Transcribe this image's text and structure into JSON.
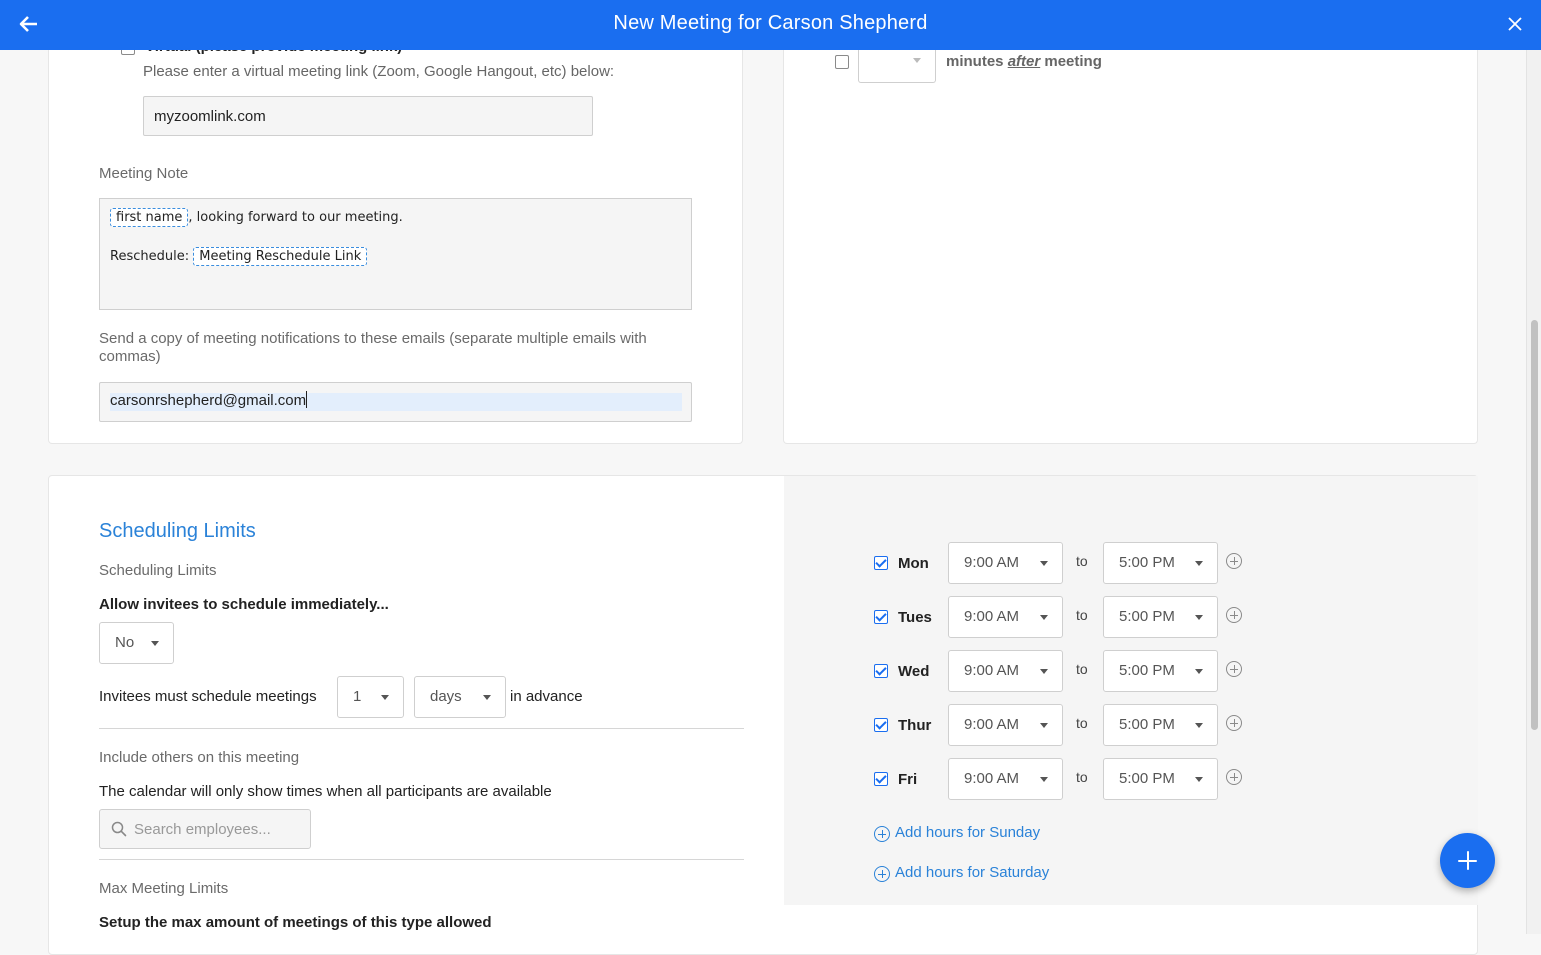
{
  "header": {
    "title": "New Meeting for Carson Shepherd"
  },
  "location": {
    "virtual_label": "Virtual (please provide meeting link)",
    "virtual_hint": "Please enter a virtual meeting link (Zoom, Google Hangout, etc) below:",
    "virtual_link": "myzoomlink.com"
  },
  "meeting_note": {
    "label": "Meeting Note",
    "token_first_name": "first name",
    "line1_rest": ", looking forward to our meeting.",
    "line2_prefix": "Reschedule:",
    "token_reschedule": "Meeting Reschedule Link"
  },
  "notify": {
    "label": "Send a copy of meeting notifications to these emails (separate multiple emails with commas)",
    "value": "carsonrshepherd@gmail.com"
  },
  "buffer": {
    "after_prefix": "minutes",
    "after_em": "after",
    "after_suffix": "meeting",
    "after_value": ""
  },
  "scheduling": {
    "section_title": "Scheduling Limits",
    "sub_label": "Scheduling Limits",
    "immediate_label": "Allow invitees to schedule immediately...",
    "immediate_value": "No",
    "advance_prefix": "Invitees must schedule meetings",
    "advance_number": "1",
    "advance_unit": "days",
    "advance_suffix": "in advance",
    "include_label": "Include others on this meeting",
    "include_hint": "The calendar will only show times when all participants are available",
    "search_placeholder": "Search employees...",
    "max_label": "Max Meeting Limits",
    "max_hint": "Setup the max amount of meetings of this type allowed"
  },
  "hours": {
    "to_label": "to",
    "days": [
      {
        "day": "Mon",
        "start": "9:00 AM",
        "end": "5:00 PM",
        "checked": true
      },
      {
        "day": "Tues",
        "start": "9:00 AM",
        "end": "5:00 PM",
        "checked": true
      },
      {
        "day": "Wed",
        "start": "9:00 AM",
        "end": "5:00 PM",
        "checked": true
      },
      {
        "day": "Thur",
        "start": "9:00 AM",
        "end": "5:00 PM",
        "checked": true
      },
      {
        "day": "Fri",
        "start": "9:00 AM",
        "end": "5:00 PM",
        "checked": true
      }
    ],
    "add_sunday": "Add hours for Sunday",
    "add_saturday": "Add hours for Saturday"
  },
  "colors": {
    "primary": "#1a6ef0",
    "link": "#2a82d8"
  }
}
